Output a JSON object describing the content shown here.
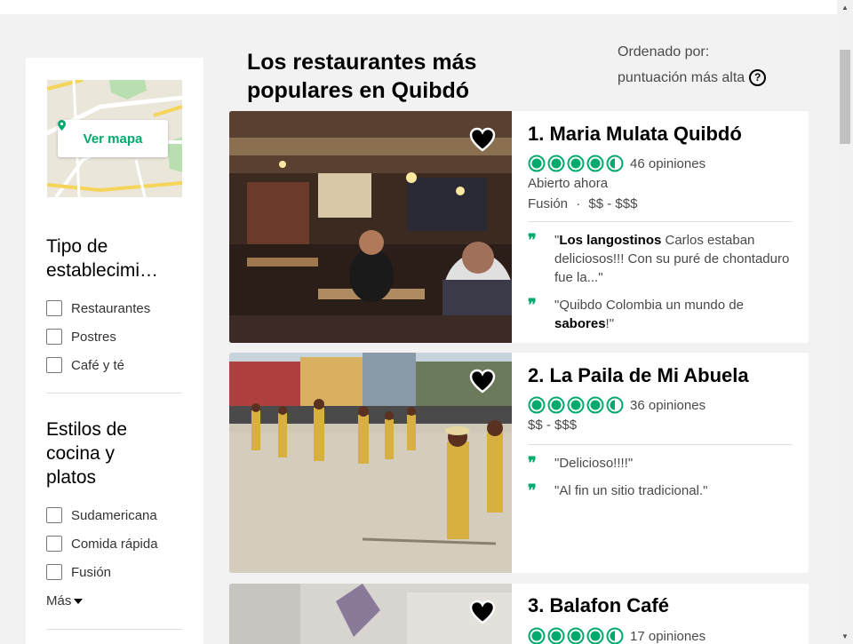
{
  "page": {
    "title": "Los restaurantes más populares en Quibdó",
    "sort_label": "Ordenado por:",
    "sort_value": "puntuación más alta"
  },
  "sidebar": {
    "map_button": "Ver mapa",
    "groups": [
      {
        "title": "Tipo de establecimi…",
        "options": [
          "Restaurantes",
          "Postres",
          "Café y té"
        ]
      },
      {
        "title": "Estilos de cocina y platos",
        "options": [
          "Sudamericana",
          "Comida rápida",
          "Fusión"
        ],
        "more_label": "Más"
      }
    ]
  },
  "restaurants": [
    {
      "name": "1. Maria Mulata Quibdó",
      "rating": 4.5,
      "reviews": "46 opiniones",
      "status": "Abierto ahora",
      "cuisine": "Fusión",
      "price": "$$ - $$$",
      "quotes": [
        {
          "bold": "Los langostinos",
          "text": " Carlos estaban deliciosos!!! Con su puré de chontaduro fue la...\""
        },
        {
          "text": "Quibdo Colombia un mundo de ",
          "bold": "sabores",
          "after": "!\""
        }
      ]
    },
    {
      "name": "2. La Paila de Mi Abuela",
      "rating": 4.5,
      "reviews": "36 opiniones",
      "price": "$$ - $$$",
      "quotes": [
        {
          "text": "\"Delicioso!!!!\""
        },
        {
          "text": "\"Al fin un sitio tradicional.\""
        }
      ]
    },
    {
      "name": "3. Balafon Café",
      "rating": 4.5,
      "reviews": "17 opiniones"
    }
  ],
  "colors": {
    "accent": "#00aa6c",
    "background": "#f2f2f2"
  }
}
